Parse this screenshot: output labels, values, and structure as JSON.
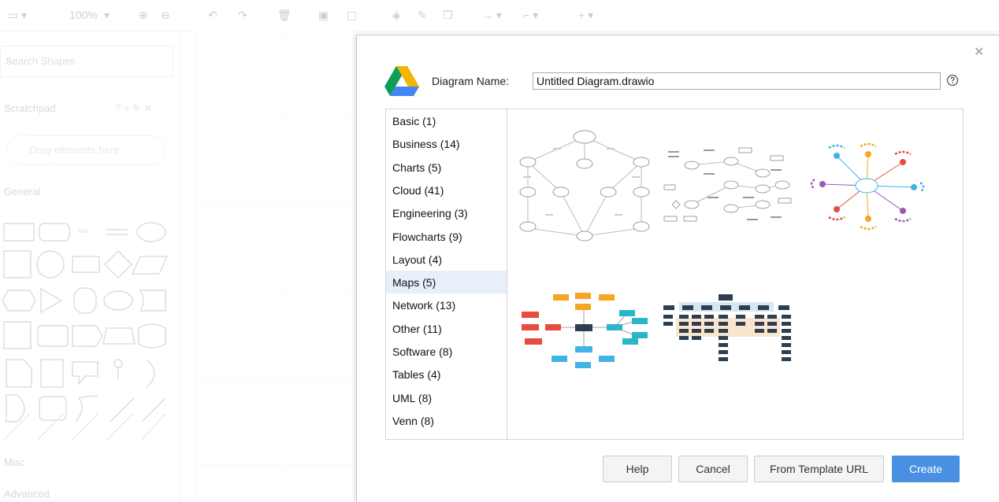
{
  "toolbar": {
    "zoom": "100%"
  },
  "sidebar": {
    "search_placeholder": "Search Shapes",
    "scratchpad_label": "Scratchpad",
    "drag_hint": "Drag elements here",
    "general_label": "General",
    "shape_text_label": "Text",
    "misc_label": "Misc",
    "advanced_label": "Advanced"
  },
  "dialog": {
    "name_label": "Diagram Name:",
    "name_value": "Untitled Diagram.drawio",
    "categories": [
      {
        "label": "Basic (1)"
      },
      {
        "label": "Business (14)"
      },
      {
        "label": "Charts (5)"
      },
      {
        "label": "Cloud (41)"
      },
      {
        "label": "Engineering (3)"
      },
      {
        "label": "Flowcharts (9)"
      },
      {
        "label": "Layout (4)"
      },
      {
        "label": "Maps (5)",
        "selected": true
      },
      {
        "label": "Network (13)"
      },
      {
        "label": "Other (11)"
      },
      {
        "label": "Software (8)"
      },
      {
        "label": "Tables (4)"
      },
      {
        "label": "UML (8)"
      },
      {
        "label": "Venn (8)"
      }
    ],
    "buttons": {
      "help": "Help",
      "cancel": "Cancel",
      "template_url": "From Template URL",
      "create": "Create"
    }
  },
  "colors": {
    "primary_button": "#4a90e2",
    "selected_category": "#e6effa",
    "gdrive_green": "#0f9d58",
    "gdrive_yellow": "#f4b400",
    "gdrive_blue": "#4285f4"
  }
}
